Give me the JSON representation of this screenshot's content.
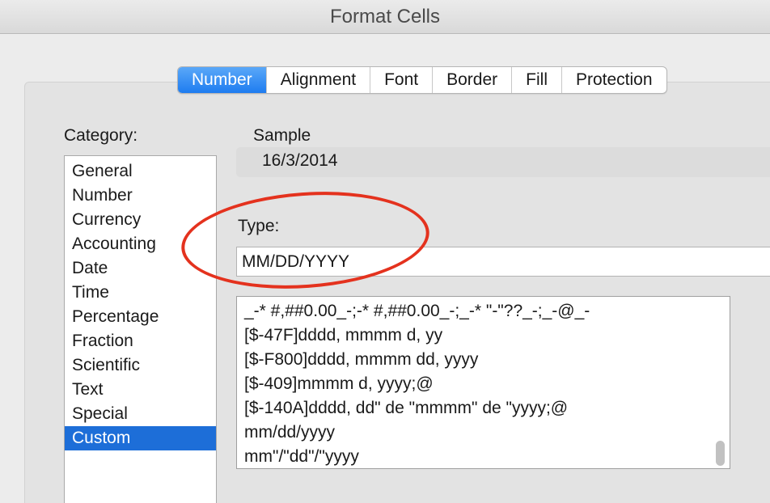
{
  "window": {
    "title": "Format Cells"
  },
  "tabs": [
    {
      "label": "Number",
      "active": true
    },
    {
      "label": "Alignment",
      "active": false
    },
    {
      "label": "Font",
      "active": false
    },
    {
      "label": "Border",
      "active": false
    },
    {
      "label": "Fill",
      "active": false
    },
    {
      "label": "Protection",
      "active": false
    }
  ],
  "category": {
    "label": "Category:",
    "items": [
      "General",
      "Number",
      "Currency",
      "Accounting",
      "Date",
      "Time",
      "Percentage",
      "Fraction",
      "Scientific",
      "Text",
      "Special",
      "Custom"
    ],
    "selected": "Custom"
  },
  "sample": {
    "label": "Sample",
    "value": "16/3/2014"
  },
  "type": {
    "label": "Type:",
    "value": "MM/DD/YYYY",
    "formats": [
      "_-* #,##0.00_-;-* #,##0.00_-;_-* \"-\"??_-;_-@_-",
      "[$-47F]dddd, mmmm d, yy",
      "[$-F800]dddd, mmmm dd, yyyy",
      "[$-409]mmmm d, yyyy;@",
      "[$-140A]dddd, dd\" de \"mmmm\" de \"yyyy;@",
      "mm/dd/yyyy",
      "mm\"/\"dd\"/\"yyyy"
    ]
  },
  "colors": {
    "accent": "#1d6ed8",
    "highlight_ring": "#e4321e"
  }
}
